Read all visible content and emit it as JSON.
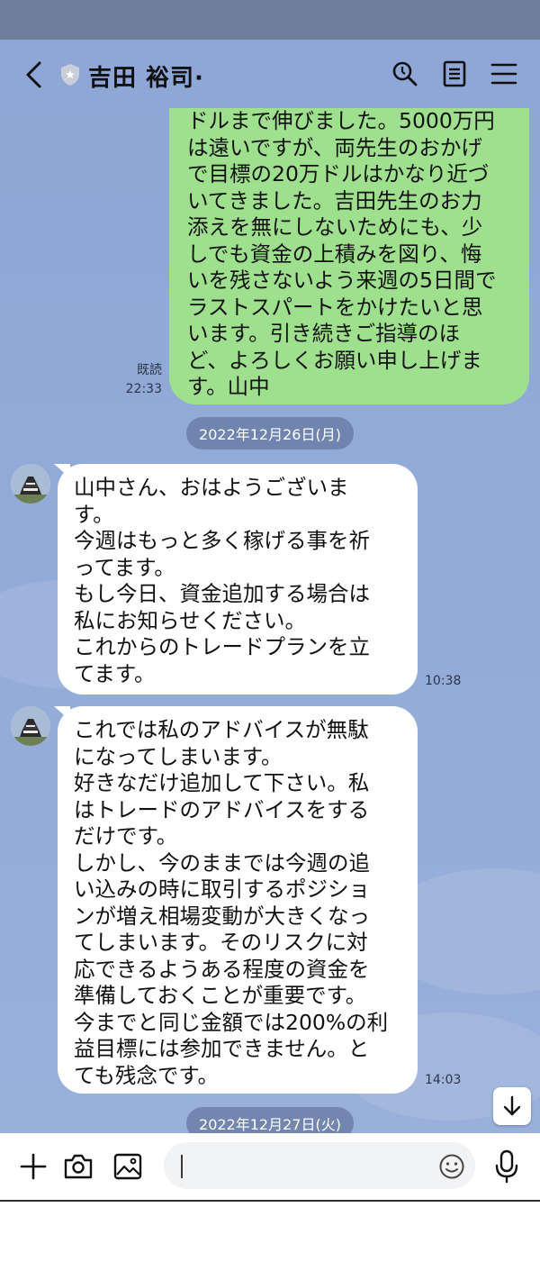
{
  "header": {
    "contact_name": "吉田 裕司·"
  },
  "messages": {
    "sent": {
      "text": "ドルまで伸びました。5000万円\nは遠いですが、両先生のおかげ\nで目標の20万ドルはかなり近づ\nいてきました。吉田先生のお力\n添えを無にしないためにも、少\nしでも資金の上積みを図り、悔\nいを残さないよう来週の5日間で\nラストスパートをかけたいと思\nいます。引き続きご指導のほ\nど、よろしくお願い申し上げま\nす。山中",
      "read_label": "既読",
      "time": "22:33"
    },
    "date_1": "2022年12月26日(月)",
    "received_1": {
      "text": "山中さん、おはようございま\nす。\n今週はもっと多く稼げる事を祈\nってます。\nもし今日、資金追加する場合は\n私にお知らせください。\nこれからのトレードプランを立\nてます。",
      "time": "10:38"
    },
    "received_2": {
      "text": "これでは私のアドバイスが無駄\nになってしまいます。\n好きなだけ追加して下さい。私\nはトレードのアドバイスをする\nだけです。\nしかし、今のままでは今週の追\nい込みの時に取引するポジショ\nンが増え相場変動が大きくなっ\nてしまいます。そのリスクに対\n応できるようある程度の資金を\n準備しておくことが重要です。\n今までと同じ金額では200%の利\n益目標には参加できません。と\nても残念です。",
      "time": "14:03"
    },
    "date_2": "2022年12月27日(火)"
  },
  "input": {
    "value": ""
  },
  "colors": {
    "chat_background": "#8ea7d6",
    "sent_bubble": "#9fe08e",
    "received_bubble": "#ffffff",
    "status_bar": "#6e7f9c"
  }
}
